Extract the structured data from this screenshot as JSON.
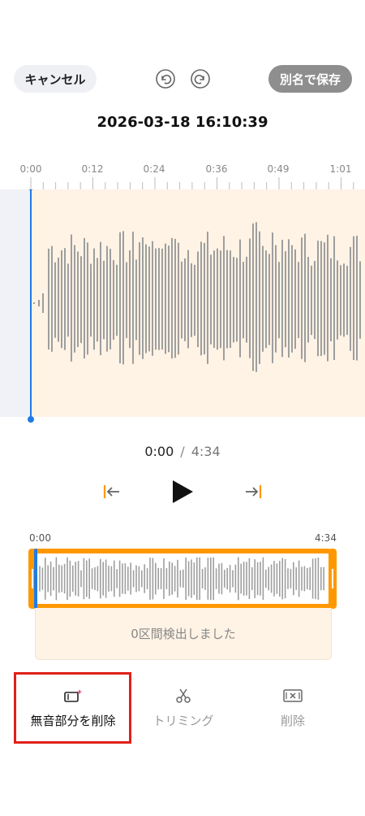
{
  "header": {
    "cancel_label": "キャンセル",
    "save_as_label": "別名で保存",
    "undo_icon": "undo-icon",
    "redo_icon": "redo-icon"
  },
  "recording": {
    "datetime": "2026-03-18 16:10:39"
  },
  "timeline": {
    "ticks": [
      "0:00",
      "0:12",
      "0:24",
      "0:36",
      "0:49",
      "1:01"
    ]
  },
  "playback": {
    "current": "0:00",
    "separator": "/",
    "total": "4:34"
  },
  "overview": {
    "start": "0:00",
    "end": "4:34",
    "detect_message": "0区間検出しました"
  },
  "tools": {
    "remove_silence_label": "無音部分を削除",
    "trim_label": "トリミング",
    "delete_label": "削除"
  },
  "colors": {
    "accent_orange": "#ff9800",
    "playhead_blue": "#1e7be6",
    "wave_bar": "#9e9e9e",
    "wave_bg": "#fff3e5",
    "highlight_red": "#e0201a"
  }
}
